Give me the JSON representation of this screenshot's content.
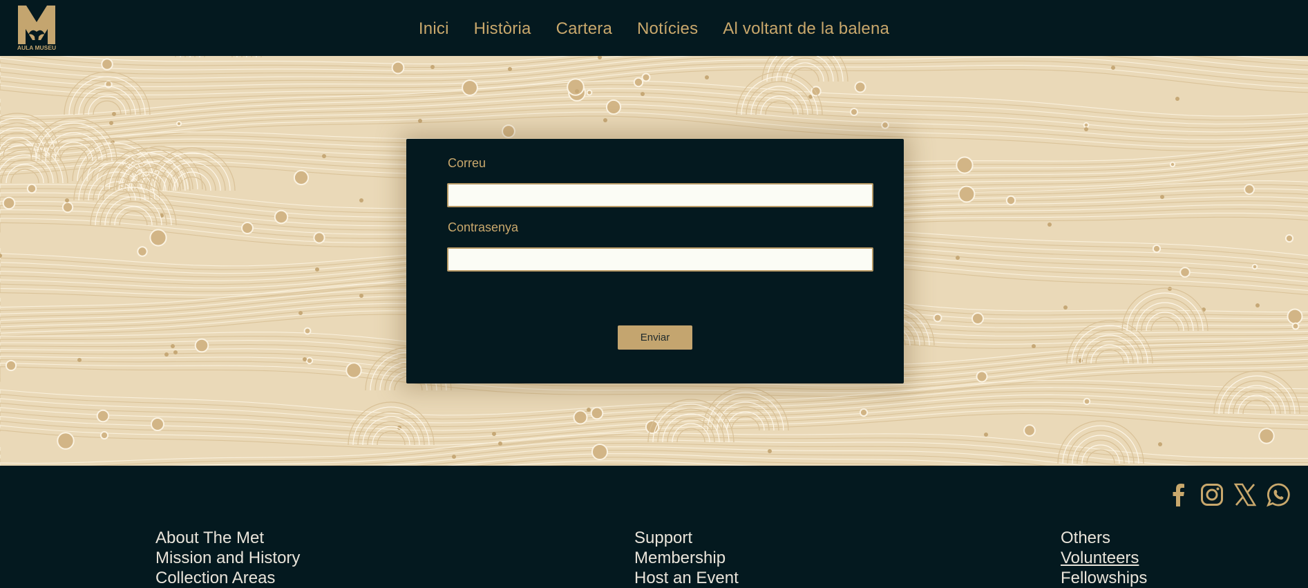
{
  "brand": {
    "logo_text": "AULA MUSEU"
  },
  "nav": {
    "items": [
      {
        "label": "Inici"
      },
      {
        "label": "Història"
      },
      {
        "label": "Cartera"
      },
      {
        "label": "Notícies"
      },
      {
        "label": "Al voltant de la balena"
      }
    ]
  },
  "login": {
    "email_label": "Correu",
    "email_value": "",
    "password_label": "Contrasenya",
    "password_value": "",
    "submit_label": "Enviar"
  },
  "footer": {
    "social_icons": [
      "facebook-icon",
      "instagram-icon",
      "x-icon",
      "whatsapp-icon"
    ],
    "columns": [
      {
        "items": [
          "About The Met",
          "Mission and History",
          "Collection Areas"
        ]
      },
      {
        "items": [
          "Support",
          "Membership",
          "Host an Event"
        ]
      },
      {
        "items": [
          "Others",
          "Volunteers",
          "Fellowships"
        ]
      }
    ]
  },
  "colors": {
    "dark_bg": "#04191f",
    "gold": "#c9a86c",
    "pattern_bg": "#ead9b8",
    "button_bg": "#c4a56f",
    "footer_text": "#e9e4da"
  }
}
